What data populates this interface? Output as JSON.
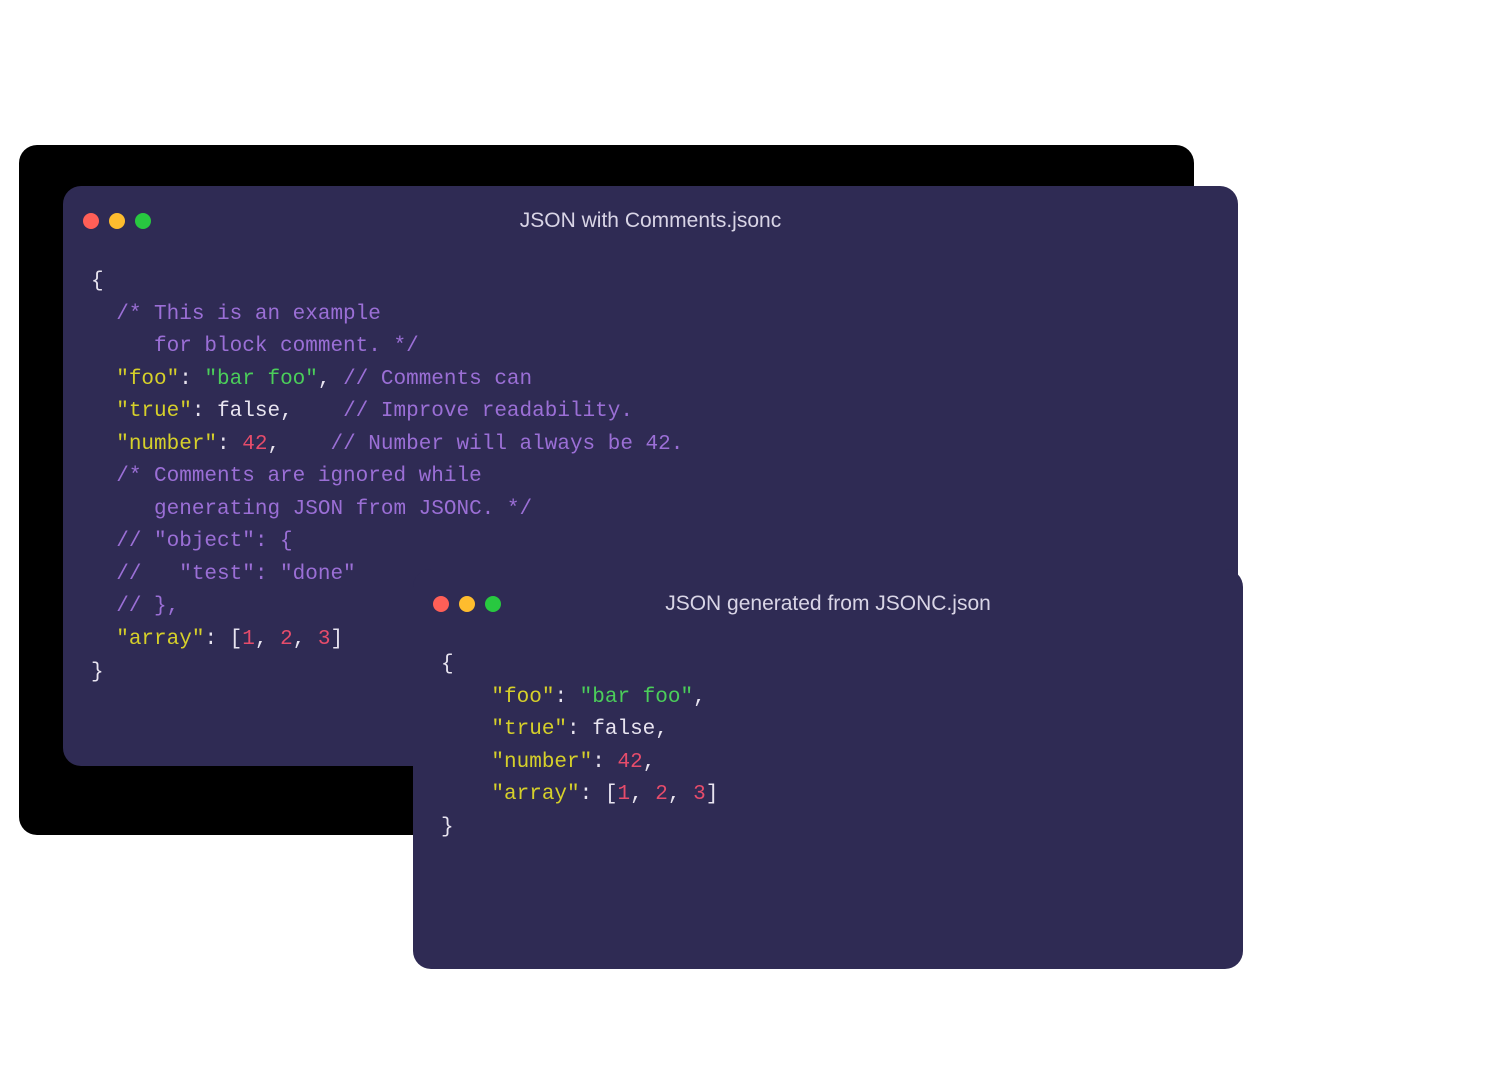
{
  "colors": {
    "window_bg": "#2f2b54",
    "comment": "#9b6fd6",
    "key": "#d6d02a",
    "string": "#4bce5a",
    "number": "#e64c6b",
    "punct": "#e8e4f0"
  },
  "window1": {
    "title": "JSON with Comments.jsonc",
    "code_tokens": [
      [
        {
          "t": "punct",
          "v": "{"
        }
      ],
      [
        {
          "t": "punct",
          "v": "  "
        },
        {
          "t": "comment",
          "v": "/* This is an example"
        }
      ],
      [
        {
          "t": "punct",
          "v": "  "
        },
        {
          "t": "comment",
          "v": "   for block comment. */"
        }
      ],
      [
        {
          "t": "punct",
          "v": "  "
        },
        {
          "t": "key",
          "v": "\"foo\""
        },
        {
          "t": "punct",
          "v": ": "
        },
        {
          "t": "string",
          "v": "\"bar foo\""
        },
        {
          "t": "punct",
          "v": ", "
        },
        {
          "t": "comment",
          "v": "// Comments can"
        }
      ],
      [
        {
          "t": "punct",
          "v": "  "
        },
        {
          "t": "key",
          "v": "\"true\""
        },
        {
          "t": "punct",
          "v": ": "
        },
        {
          "t": "bool",
          "v": "false"
        },
        {
          "t": "punct",
          "v": ",    "
        },
        {
          "t": "comment",
          "v": "// Improve readability."
        }
      ],
      [
        {
          "t": "punct",
          "v": "  "
        },
        {
          "t": "key",
          "v": "\"number\""
        },
        {
          "t": "punct",
          "v": ": "
        },
        {
          "t": "number",
          "v": "42"
        },
        {
          "t": "punct",
          "v": ",    "
        },
        {
          "t": "comment",
          "v": "// Number will always be 42."
        }
      ],
      [
        {
          "t": "punct",
          "v": "  "
        },
        {
          "t": "comment",
          "v": "/* Comments are ignored while"
        }
      ],
      [
        {
          "t": "punct",
          "v": "  "
        },
        {
          "t": "comment",
          "v": "   generating JSON from JSONC. */"
        }
      ],
      [
        {
          "t": "punct",
          "v": "  "
        },
        {
          "t": "comment",
          "v": "// \"object\": {"
        }
      ],
      [
        {
          "t": "punct",
          "v": "  "
        },
        {
          "t": "comment",
          "v": "//   \"test\": \"done\""
        }
      ],
      [
        {
          "t": "punct",
          "v": "  "
        },
        {
          "t": "comment",
          "v": "// },"
        }
      ],
      [
        {
          "t": "punct",
          "v": "  "
        },
        {
          "t": "key",
          "v": "\"array\""
        },
        {
          "t": "punct",
          "v": ": ["
        },
        {
          "t": "number",
          "v": "1"
        },
        {
          "t": "punct",
          "v": ", "
        },
        {
          "t": "number",
          "v": "2"
        },
        {
          "t": "punct",
          "v": ", "
        },
        {
          "t": "number",
          "v": "3"
        },
        {
          "t": "punct",
          "v": "]"
        }
      ],
      [
        {
          "t": "punct",
          "v": "}"
        }
      ]
    ]
  },
  "window2": {
    "title": "JSON generated from JSONC.json",
    "code_tokens": [
      [
        {
          "t": "punct",
          "v": "{"
        }
      ],
      [
        {
          "t": "punct",
          "v": "    "
        },
        {
          "t": "key",
          "v": "\"foo\""
        },
        {
          "t": "punct",
          "v": ": "
        },
        {
          "t": "string",
          "v": "\"bar foo\""
        },
        {
          "t": "punct",
          "v": ","
        }
      ],
      [
        {
          "t": "punct",
          "v": "    "
        },
        {
          "t": "key",
          "v": "\"true\""
        },
        {
          "t": "punct",
          "v": ": "
        },
        {
          "t": "bool",
          "v": "false"
        },
        {
          "t": "punct",
          "v": ","
        }
      ],
      [
        {
          "t": "punct",
          "v": "    "
        },
        {
          "t": "key",
          "v": "\"number\""
        },
        {
          "t": "punct",
          "v": ": "
        },
        {
          "t": "number",
          "v": "42"
        },
        {
          "t": "punct",
          "v": ","
        }
      ],
      [
        {
          "t": "punct",
          "v": "    "
        },
        {
          "t": "key",
          "v": "\"array\""
        },
        {
          "t": "punct",
          "v": ": ["
        },
        {
          "t": "number",
          "v": "1"
        },
        {
          "t": "punct",
          "v": ", "
        },
        {
          "t": "number",
          "v": "2"
        },
        {
          "t": "punct",
          "v": ", "
        },
        {
          "t": "number",
          "v": "3"
        },
        {
          "t": "punct",
          "v": "]"
        }
      ],
      [
        {
          "t": "punct",
          "v": "}"
        }
      ]
    ]
  }
}
